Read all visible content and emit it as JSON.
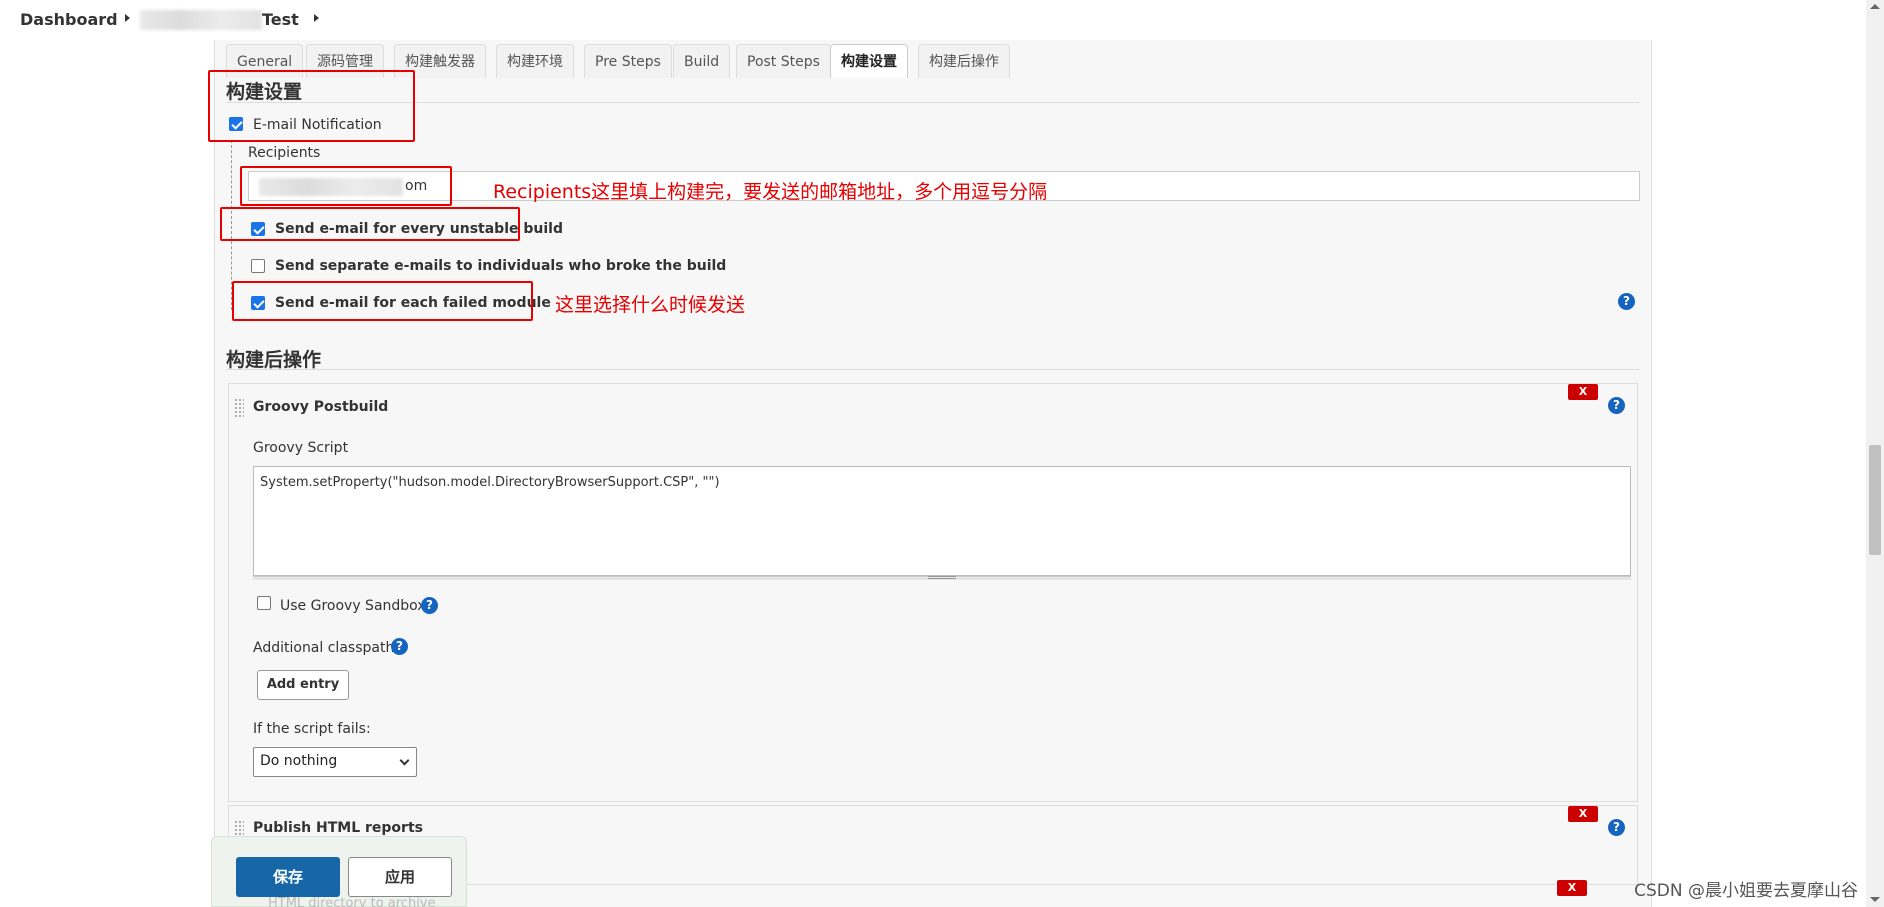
{
  "breadcrumb": {
    "dashboard": "Dashboard",
    "job_suffix": "Test"
  },
  "tabs": [
    "General",
    "源码管理",
    "构建触发器",
    "构建环境",
    "Pre Steps",
    "Build",
    "Post Steps",
    "构建设置",
    "构建后操作"
  ],
  "active_tab": "构建设置",
  "build_settings": {
    "title": "构建设置",
    "email_notification_label": "E-mail Notification",
    "recipients_label": "Recipients",
    "recipients_value_suffix": "om",
    "opt_unstable": "Send e-mail for every unstable build",
    "opt_separate": "Send separate e-mails to individuals who broke the build",
    "opt_failed_module": "Send e-mail for each failed module"
  },
  "post_build": {
    "title": "构建后操作",
    "groovy": {
      "title": "Groovy Postbuild",
      "script_label": "Groovy Script",
      "script_value": "System.setProperty(\"hudson.model.DirectoryBrowserSupport.CSP\", \"\")",
      "sandbox_label": "Use Groovy Sandbox",
      "classpath_label": "Additional classpath",
      "add_entry": "Add entry",
      "if_fails_label": "If the script fails:",
      "if_fails_value": "Do nothing"
    },
    "html_reports": {
      "title": "Publish HTML reports",
      "faded_label": "HTML directory to archive"
    },
    "delete_label": "X"
  },
  "annotations": {
    "recipients_note": "Recipients这里填上构建完，要发送的邮箱地址，多个用逗号分隔",
    "when_note": "这里选择什么时候发送"
  },
  "actions": {
    "save": "保存",
    "apply": "应用"
  },
  "watermark": "CSDN @晨小姐要去夏摩山谷",
  "help_glyph": "?",
  "colors": {
    "annotation_red": "#e60000",
    "save_blue": "#1767a8",
    "help_blue": "#1565c0",
    "delete_red": "#cc0000"
  }
}
